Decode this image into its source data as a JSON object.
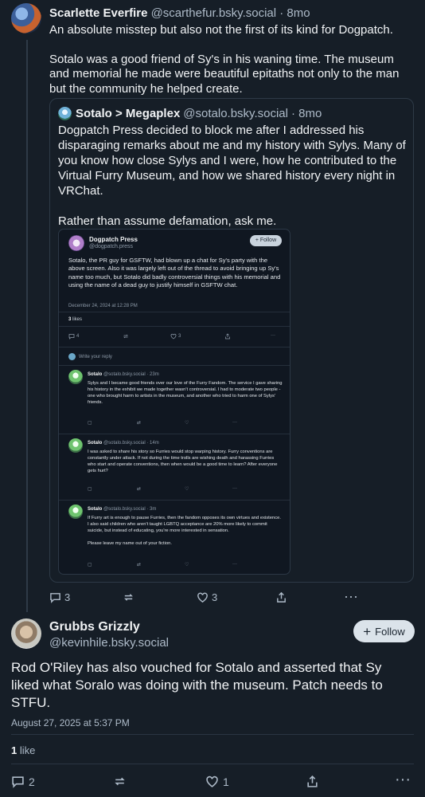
{
  "parent_post": {
    "author_name": "Scarlette Everfire",
    "author_handle": "@scarthefur.bsky.social",
    "time": "· 8mo",
    "paragraphs": [
      "An absolute misstep but also not the first of its kind for Dogpatch.",
      "Sotalo was a good friend of Sy's in his waning time.  The museum and memorial he made were beautiful epitaths not only to the man but the community he helped create."
    ],
    "actions": {
      "replies": "3",
      "reposts": "",
      "likes": "3"
    }
  },
  "quoted_post": {
    "author_name": "Sotalo > Megaplex",
    "author_handle": "@sotalo.bsky.social",
    "time": "· 8mo",
    "paragraphs": [
      "Dogpatch Press decided to block me after I addressed his disparaging remarks about me and my history with Sylys. Many of you know how close Sylys and I were, how he contributed to the Virtual Furry Museum, and how we shared history every night in VRChat.",
      "Rather than assume defamation, ask me."
    ]
  },
  "embedded_screenshot": {
    "author_name": "Dogpatch Press",
    "author_handle": "@dogpatch.press",
    "follow_label": "+ Follow",
    "text": "Sotalo, the PR guy for GSFTW, had blown up a chat for Sy's party with the above screen. Also it was largely left out of the thread to avoid bringing up Sy's name too much, but Sotalo did badly controversial things with his memorial and using the name of a dead guy to justify himself in GSFTW chat.",
    "date": "December 24, 2024 at 12:28 PM",
    "likes_count": "3",
    "likes_label": "likes",
    "actions": {
      "replies": "4",
      "likes": "3"
    },
    "reply_placeholder": "Write your reply",
    "comments": [
      {
        "name": "Sotalo",
        "meta": "@sotalo.bsky.social · 23m",
        "paragraphs": [
          "Sylys and I became good friends over our love of the Furry Fandom. The service I gave sharing his history in the exhibit we made together wasn't controversial. I had to moderate two people - one who brought harm to artists in the museum, and another who tried to harm one of Sylys' friends."
        ]
      },
      {
        "name": "Sotalo",
        "meta": "@sotalo.bsky.social · 14m",
        "paragraphs": [
          "I was asked to share his story so Furries would stop warping history. Furry conventions are constantly under attack. If not during the time trolls are wishing death and harassing Furries who start and operate conventions, then when would be a good time to learn? After everyone gets hurt?"
        ]
      },
      {
        "name": "Sotalo",
        "meta": "@sotalo.bsky.social · 3m",
        "paragraphs": [
          "If Furry art is enough to pause Furries, then the fandom opposes its own virtues and existence. I also said children who aren't taught LGBTQ acceptance are 20% more likely to commit suicide, but instead of educating, you're more interested in sensation.",
          "Please leave my name out of your fiction."
        ]
      }
    ]
  },
  "main_post": {
    "author_name": "Grubbs Grizzly",
    "author_handle": "@kevinhile.bsky.social",
    "follow_label": "Follow",
    "text": "Rod O'Riley has also vouched for Sotalo and asserted that Sy liked what Soralo was doing with the museum. Patch needs to STFU.",
    "date": "August 27, 2025 at 5:37 PM",
    "likes_count": "1",
    "likes_label": "like",
    "actions": {
      "replies": "2",
      "likes": "1"
    }
  }
}
